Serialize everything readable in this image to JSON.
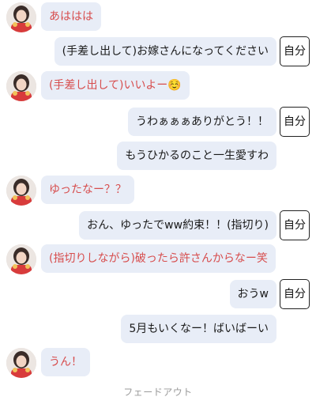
{
  "messages": [
    {
      "side": "them",
      "text": "あははは"
    },
    {
      "side": "me",
      "text": "(手差し出して)お嫁さんになってください",
      "tag": "自分"
    },
    {
      "side": "them",
      "text": "(手差し出して)いいよー☺️"
    },
    {
      "side": "me",
      "text": "うわぁぁぁありがとう！！",
      "tag": "自分"
    },
    {
      "side": "me",
      "text": "もうひかるのこと一生愛すわ"
    },
    {
      "side": "them",
      "text": "ゆったなー？？"
    },
    {
      "side": "me",
      "text": "おん、ゆったでww約束！！(指切り)",
      "tag": "自分"
    },
    {
      "side": "them",
      "text": "(指切りしながら)破ったら許さんからなー笑"
    },
    {
      "side": "me",
      "text": "おうw",
      "tag": "自分"
    },
    {
      "side": "me",
      "text": "5月もいくなー！ばいばーい"
    },
    {
      "side": "them",
      "text": "うん！"
    }
  ],
  "footer": "フェードアウト",
  "colors": {
    "bubble": "#e8edf7",
    "them_text": "#d74d4d",
    "me_text": "#1a1a1a"
  },
  "icons": {
    "avatar": "avatar-icon"
  }
}
